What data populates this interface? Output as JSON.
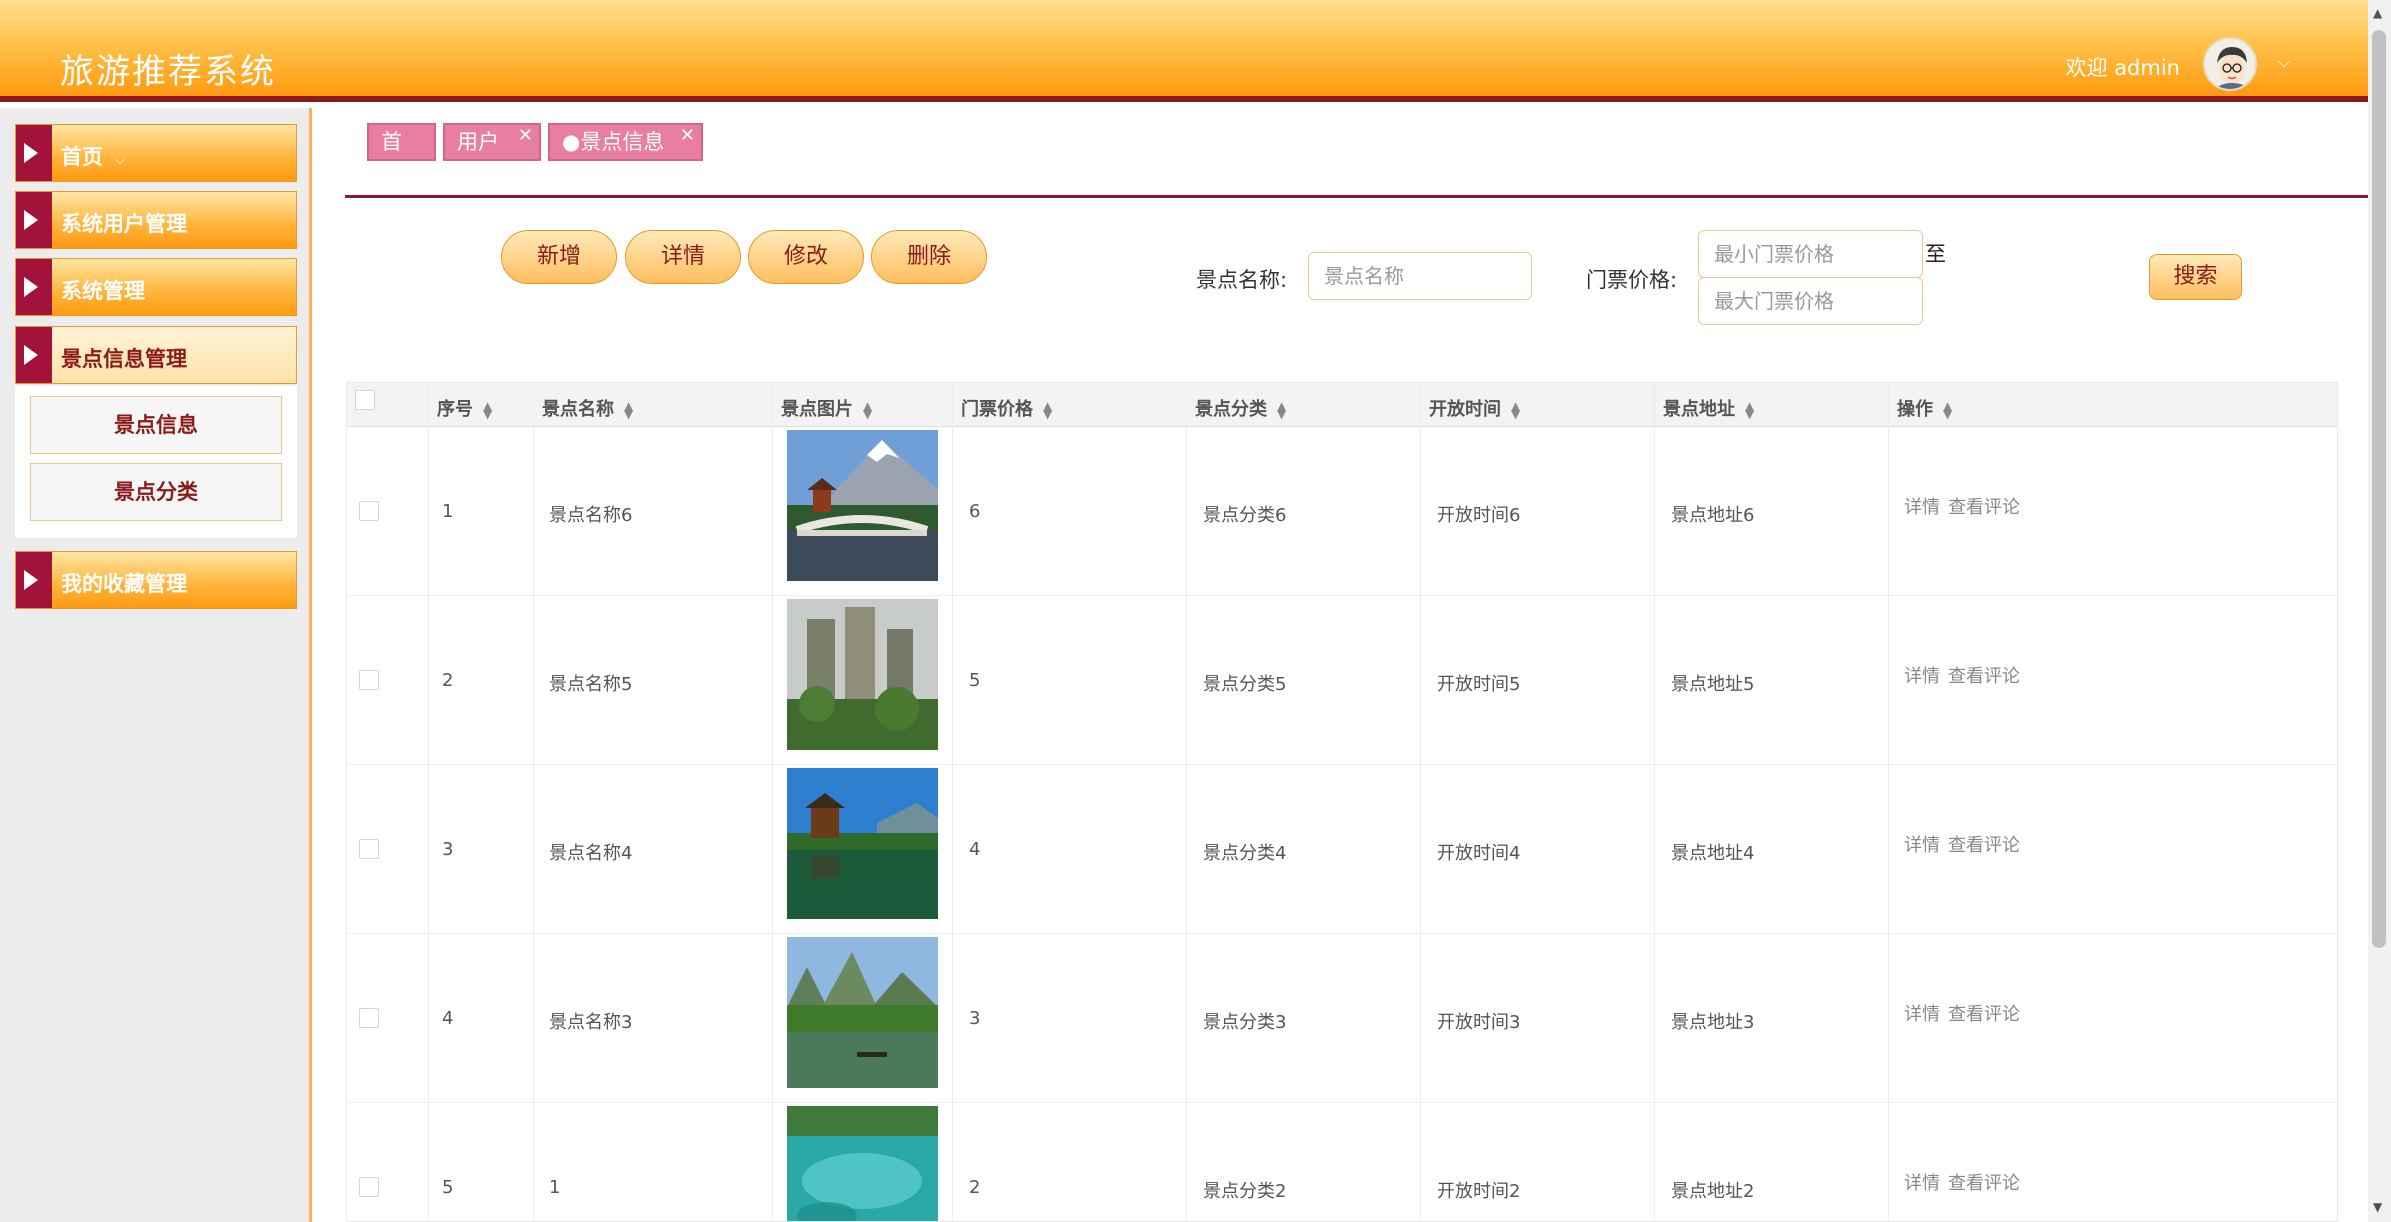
{
  "header": {
    "title": "旅游推荐系统",
    "welcome": "欢迎 admin",
    "chevron": "⌵"
  },
  "sidebar": {
    "items": [
      {
        "label": "首页",
        "extra": "⌵"
      },
      {
        "label": "系统用户管理"
      },
      {
        "label": "系统管理"
      },
      {
        "label": "景点信息管理"
      },
      {
        "label": "我的收藏管理"
      }
    ],
    "subitems": [
      {
        "label": "景点信息"
      },
      {
        "label": "景点分类"
      }
    ]
  },
  "tabs": [
    {
      "label": "首页"
    },
    {
      "label": "用户",
      "close": "✕"
    },
    {
      "label": "●景点信息",
      "close": "✕"
    }
  ],
  "toolbar": {
    "add": "新增",
    "detail": "详情",
    "edit": "修改",
    "delete": "删除"
  },
  "search": {
    "name_label": "景点名称:",
    "name_placeholder": "景点名称",
    "price_label": "门票价格:",
    "min_placeholder": "最小门票价格",
    "max_placeholder": "最大门票价格",
    "to": "至",
    "button": "搜索"
  },
  "table": {
    "headers": [
      "序号",
      "景点名称",
      "景点图片",
      "门票价格",
      "景点分类",
      "开放时间",
      "景点地址",
      "操作"
    ],
    "sort_icon": "▲▼",
    "rows": [
      {
        "no": "1",
        "name": "景点名称6",
        "price": "6",
        "category": "景点分类6",
        "open": "开放时间6",
        "address": "景点地址6",
        "img": "mountain-pagoda"
      },
      {
        "no": "2",
        "name": "景点名称5",
        "price": "5",
        "category": "景点分类5",
        "open": "开放时间5",
        "address": "景点地址5",
        "img": "misty-peaks"
      },
      {
        "no": "3",
        "name": "景点名称4",
        "price": "4",
        "category": "景点分类4",
        "open": "开放时间4",
        "address": "景点地址4",
        "img": "pavilion-lake"
      },
      {
        "no": "4",
        "name": "景点名称3",
        "price": "3",
        "category": "景点分类3",
        "open": "开放时间3",
        "address": "景点地址3",
        "img": "karst-river"
      },
      {
        "no": "5",
        "name": "1",
        "price": "2",
        "category": "景点分类2",
        "open": "开放时间2",
        "address": "景点地址2",
        "img": "turquoise-pool"
      }
    ],
    "op_detail": "详情",
    "op_comments": "查看评论"
  },
  "colors": {
    "accent": "#ff9a10",
    "dark_red": "#8b1a1a",
    "tab_pink": "#e87fa0"
  }
}
